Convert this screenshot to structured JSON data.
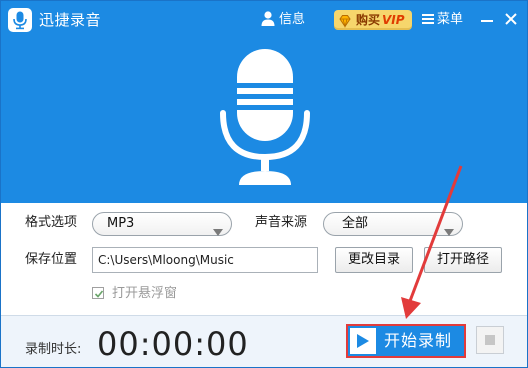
{
  "app": {
    "title": "迅捷录音"
  },
  "titlebar": {
    "info_label": "信息",
    "vip_label": "购买",
    "vip_badge": "VIP",
    "menu_label": "菜单",
    "icons": [
      "user-icon",
      "diamond-icon",
      "menu-icon",
      "minimize-icon",
      "close-icon"
    ]
  },
  "settings": {
    "format_label": "格式选项",
    "format_value": "MP3",
    "source_label": "声音来源",
    "source_value": "全部",
    "save_label": "保存位置",
    "save_path": "C:\\Users\\Mloong\\Music",
    "change_dir_label": "更改目录",
    "open_path_label": "打开路径",
    "float_window_label": "打开悬浮窗",
    "float_window_checked": true
  },
  "bottom": {
    "timer_label": "录制时长:",
    "timer_value": "00:00:00",
    "start_label": "开始录制"
  },
  "colors": {
    "primary_blue": "#1c8ae3",
    "highlight_red": "#e23b3b",
    "vip_gold": "#f6d66c"
  }
}
